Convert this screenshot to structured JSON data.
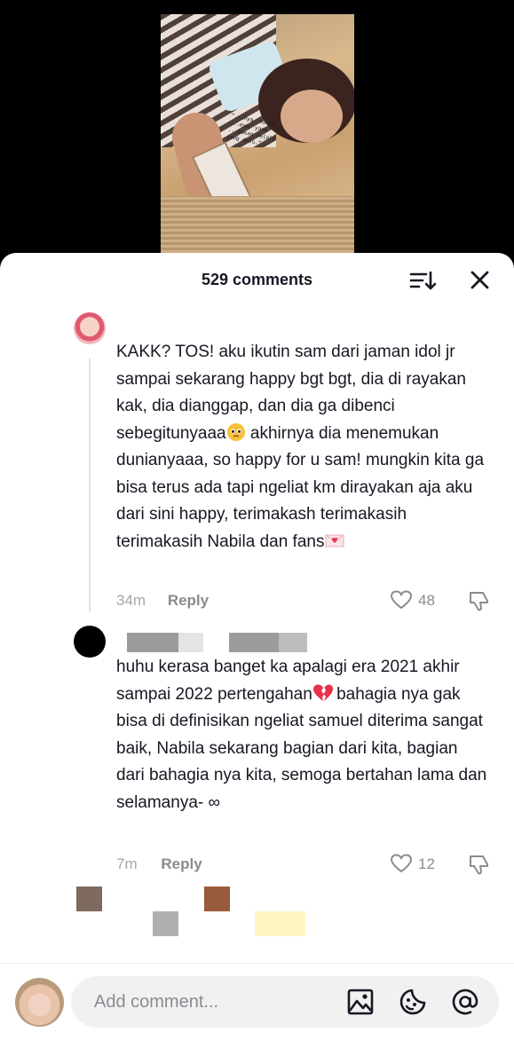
{
  "video": {
    "caption": "“...nya, hanya\n...ayo, yang\n...bukan selalu\nyang dulu.”"
  },
  "header": {
    "comment_count": "529 comments",
    "sort_icon": "sort-lines-icon",
    "close_icon": "close-icon"
  },
  "comments": [
    {
      "text": "KAKK? TOS! aku ikutin sam dari jaman idol jr sampai sekarang happy bgt bgt, dia di rayakan kak, dia dianggap, dan dia ga dibenci sebegitunyaaa",
      "text_2": " akhirnya dia menemukan dunianyaaa, so happy for u sam! mungkin kita ga bisa terus ada tapi ngeliat km dirayakan aja aku dari sini happy, terimakash terimakasih terimakasih Nabila dan fans",
      "time": "34m",
      "reply_label": "Reply",
      "likes": "48"
    },
    {
      "text": "huhu kerasa banget ka apalagi era 2021 akhir sampai 2022 pertengahan",
      "text_2": " bahagia nya gak bisa di definisikan ngeliat samuel diterima sangat baik, Nabila sekarang bagian dari kita, bagian dari bahagia nya kita, semoga bertahan lama dan selamanya- ∞",
      "time": "7m",
      "reply_label": "Reply",
      "likes": "12"
    }
  ],
  "composer": {
    "placeholder": "Add comment...",
    "icons": [
      "image-icon",
      "sticker-icon",
      "mention-icon"
    ]
  },
  "colors": {
    "text": "#161823",
    "muted": "#8a8b91",
    "pill": "#f1f1f2"
  }
}
